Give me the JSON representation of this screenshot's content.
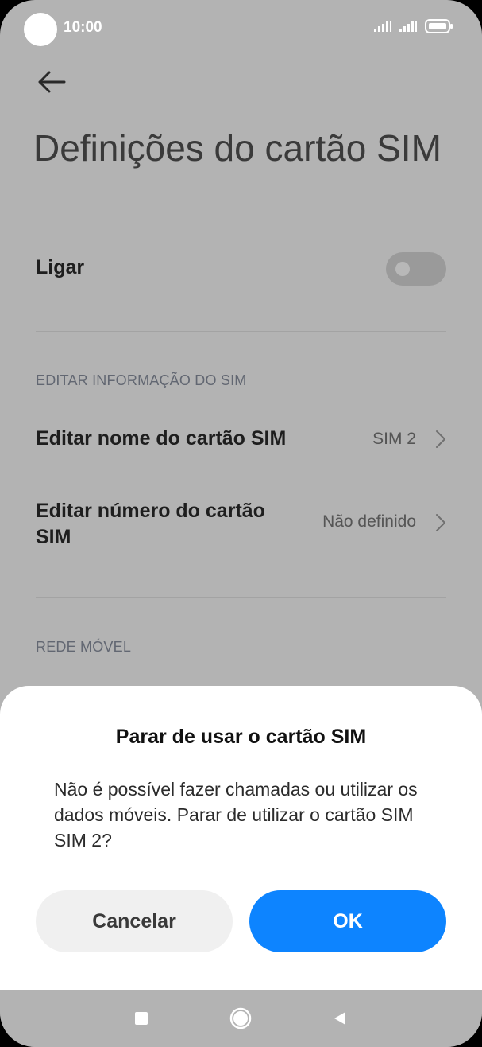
{
  "status_bar": {
    "time": "10:00",
    "icons": [
      "camera-cutout",
      "signal-icon",
      "signal-icon",
      "battery-icon"
    ]
  },
  "header": {
    "back_icon": "arrow-left-icon",
    "title": "Definições do cartão SIM"
  },
  "settings": {
    "power": {
      "label": "Ligar",
      "toggle_on": false
    },
    "section_edit": "EDITAR INFORMAÇÃO DO SIM",
    "items": [
      {
        "label": "Editar nome do cartão SIM",
        "value": "SIM 2",
        "icon": "chevron-right-icon"
      },
      {
        "label": "Editar número do cartão SIM",
        "value": "Não definido",
        "icon": "chevron-right-icon"
      }
    ],
    "section_network": "REDE MÓVEL"
  },
  "dialog": {
    "title": "Parar de usar o cartão SIM",
    "message": "Não é possível fazer chamadas ou utilizar os dados móveis. Parar de utilizar o cartão SIM SIM 2?",
    "cancel_label": "Cancelar",
    "ok_label": "OK"
  },
  "nav_bar": {
    "icons": [
      "recent-apps-icon",
      "home-icon",
      "back-icon"
    ]
  },
  "colors": {
    "accent": "#0d84ff",
    "scrim_background": "#b3b3b3",
    "dialog_background": "#ffffff",
    "cancel_background": "#f0f0f0"
  }
}
